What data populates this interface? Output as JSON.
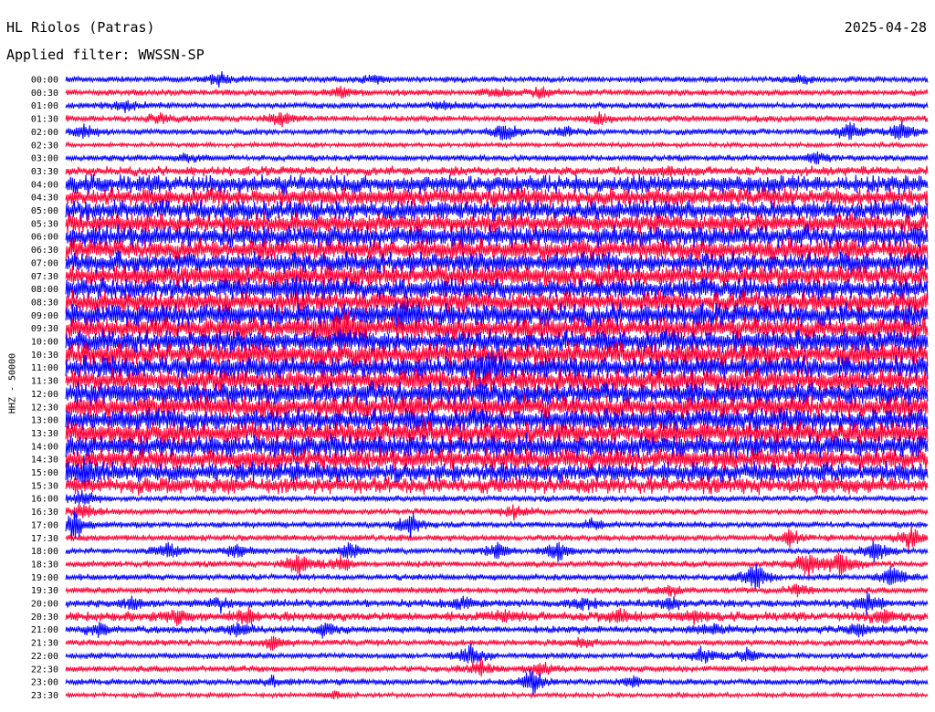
{
  "header": {
    "station": "HL Riolos (Patras)",
    "date": "2025-04-28",
    "filter": "Applied filter: WWSSN-SP"
  },
  "chart_data": {
    "type": "line",
    "title": "HL Riolos (Patras)",
    "ylabel": "HHZ - 50000",
    "xlabel": "",
    "colors": [
      "#0000ff",
      "#ff0033"
    ],
    "rows": [
      {
        "label": "00:00",
        "amp": 4,
        "events": [
          [
            0.18,
            9
          ],
          [
            0.36,
            6
          ],
          [
            0.85,
            5
          ]
        ]
      },
      {
        "label": "00:30",
        "amp": 4,
        "events": [
          [
            0.32,
            6
          ],
          [
            0.5,
            6
          ],
          [
            0.55,
            7
          ]
        ]
      },
      {
        "label": "01:00",
        "amp": 4,
        "events": [
          [
            0.07,
            7
          ],
          [
            0.44,
            5
          ]
        ]
      },
      {
        "label": "01:30",
        "amp": 4,
        "events": [
          [
            0.11,
            6
          ],
          [
            0.25,
            9
          ],
          [
            0.62,
            6
          ]
        ]
      },
      {
        "label": "02:00",
        "amp": 4,
        "events": [
          [
            0.02,
            10
          ],
          [
            0.51,
            12
          ],
          [
            0.58,
            6
          ],
          [
            0.91,
            13
          ],
          [
            0.97,
            12
          ]
        ]
      },
      {
        "label": "02:30",
        "amp": 3,
        "events": []
      },
      {
        "label": "03:00",
        "amp": 4,
        "events": [
          [
            0.14,
            5
          ],
          [
            0.87,
            7
          ]
        ]
      },
      {
        "label": "03:30",
        "amp": 6,
        "events": [
          [
            0.7,
            6
          ]
        ]
      },
      {
        "label": "04:00",
        "amp": 12,
        "events": []
      },
      {
        "label": "04:30",
        "amp": 12,
        "events": []
      },
      {
        "label": "05:00",
        "amp": 13,
        "events": []
      },
      {
        "label": "05:30",
        "amp": 13,
        "events": []
      },
      {
        "label": "06:00",
        "amp": 14,
        "events": []
      },
      {
        "label": "06:30",
        "amp": 14,
        "events": []
      },
      {
        "label": "07:00",
        "amp": 14,
        "events": []
      },
      {
        "label": "07:30",
        "amp": 14,
        "events": []
      },
      {
        "label": "08:00",
        "amp": 14,
        "events": [
          [
            0.27,
            10
          ]
        ]
      },
      {
        "label": "08:30",
        "amp": 14,
        "events": []
      },
      {
        "label": "09:00",
        "amp": 15,
        "events": [
          [
            0.39,
            14
          ]
        ]
      },
      {
        "label": "09:30",
        "amp": 15,
        "events": [
          [
            0.32,
            22
          ]
        ]
      },
      {
        "label": "10:00",
        "amp": 15,
        "events": []
      },
      {
        "label": "10:30",
        "amp": 15,
        "events": []
      },
      {
        "label": "11:00",
        "amp": 15,
        "events": [
          [
            0.49,
            14
          ]
        ]
      },
      {
        "label": "11:30",
        "amp": 15,
        "events": []
      },
      {
        "label": "12:00",
        "amp": 15,
        "events": []
      },
      {
        "label": "12:30",
        "amp": 15,
        "events": []
      },
      {
        "label": "13:00",
        "amp": 15,
        "events": []
      },
      {
        "label": "13:30",
        "amp": 15,
        "events": []
      },
      {
        "label": "14:00",
        "amp": 15,
        "events": []
      },
      {
        "label": "14:30",
        "amp": 14,
        "events": []
      },
      {
        "label": "15:00",
        "amp": 13,
        "events": [
          [
            0.02,
            12
          ]
        ]
      },
      {
        "label": "15:30",
        "amp": 11,
        "events": []
      },
      {
        "label": "16:00",
        "amp": 4,
        "events": [
          [
            0.02,
            10
          ]
        ]
      },
      {
        "label": "16:30",
        "amp": 4,
        "events": [
          [
            0.02,
            12
          ],
          [
            0.52,
            8
          ]
        ]
      },
      {
        "label": "17:00",
        "amp": 4,
        "events": [
          [
            0.01,
            18
          ],
          [
            0.4,
            16
          ],
          [
            0.61,
            6
          ]
        ]
      },
      {
        "label": "17:30",
        "amp": 4,
        "events": [
          [
            0.84,
            10
          ],
          [
            0.98,
            16
          ]
        ]
      },
      {
        "label": "18:00",
        "amp": 4,
        "events": [
          [
            0.12,
            10
          ],
          [
            0.2,
            10
          ],
          [
            0.33,
            10
          ],
          [
            0.5,
            10
          ],
          [
            0.57,
            12
          ],
          [
            0.94,
            14
          ]
        ]
      },
      {
        "label": "18:30",
        "amp": 4,
        "events": [
          [
            0.27,
            14
          ],
          [
            0.32,
            10
          ],
          [
            0.86,
            16
          ],
          [
            0.9,
            16
          ]
        ]
      },
      {
        "label": "19:00",
        "amp": 4,
        "events": [
          [
            0.8,
            18
          ],
          [
            0.96,
            14
          ]
        ]
      },
      {
        "label": "19:30",
        "amp": 4,
        "events": [
          [
            0.7,
            7
          ],
          [
            0.85,
            8
          ]
        ]
      },
      {
        "label": "20:00",
        "amp": 5,
        "events": [
          [
            0.08,
            9
          ],
          [
            0.18,
            7
          ],
          [
            0.46,
            8
          ],
          [
            0.6,
            7
          ],
          [
            0.7,
            8
          ],
          [
            0.93,
            14
          ]
        ]
      },
      {
        "label": "20:30",
        "amp": 6,
        "events": [
          [
            0.13,
            8
          ],
          [
            0.21,
            10
          ],
          [
            0.51,
            8
          ],
          [
            0.64,
            9
          ],
          [
            0.73,
            8
          ],
          [
            0.95,
            9
          ]
        ]
      },
      {
        "label": "21:00",
        "amp": 5,
        "events": [
          [
            0.04,
            8
          ],
          [
            0.2,
            8
          ],
          [
            0.3,
            7
          ],
          [
            0.75,
            8
          ],
          [
            0.92,
            8
          ]
        ]
      },
      {
        "label": "21:30",
        "amp": 4,
        "events": [
          [
            0.24,
            8
          ],
          [
            0.6,
            6
          ]
        ]
      },
      {
        "label": "22:00",
        "amp": 4,
        "events": [
          [
            0.47,
            12
          ],
          [
            0.74,
            10
          ],
          [
            0.79,
            8
          ]
        ]
      },
      {
        "label": "22:30",
        "amp": 4,
        "events": [
          [
            0.48,
            10
          ],
          [
            0.55,
            9
          ]
        ]
      },
      {
        "label": "23:00",
        "amp": 4,
        "events": [
          [
            0.54,
            16
          ],
          [
            0.24,
            6
          ],
          [
            0.66,
            7
          ]
        ]
      },
      {
        "label": "23:30",
        "amp": 3,
        "events": [
          [
            0.31,
            5
          ]
        ]
      }
    ]
  }
}
